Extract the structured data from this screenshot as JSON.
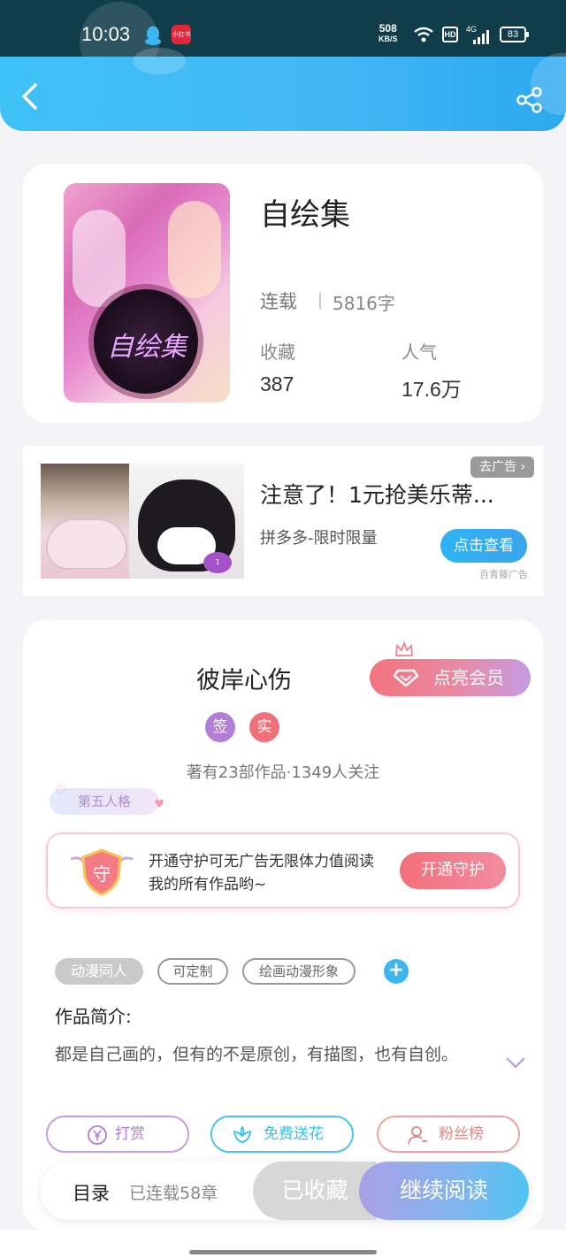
{
  "status_bar": {
    "time": "10:03",
    "app_badge": "小红书",
    "speed_value": "508",
    "speed_unit": "KB/S",
    "hd": "HD",
    "network": "4G",
    "battery": "83"
  },
  "book": {
    "title": "自绘集",
    "status": "连载",
    "word_count": "5816字",
    "stats": [
      {
        "label": "收藏",
        "value": "387"
      },
      {
        "label": "人气",
        "value": "17.6万"
      }
    ]
  },
  "ad": {
    "badge": "去广告",
    "title": "注意了！1元抢美乐蒂...",
    "subtitle": "拼多多-限时限量",
    "button": "点击查看",
    "source": "百青藤广告"
  },
  "author": {
    "name": "彼岸心伤",
    "vip_button": "点亮会员",
    "badges": [
      {
        "label": "签",
        "color": "#b57ed6"
      },
      {
        "label": "实",
        "color": "#ef7079"
      }
    ],
    "meta": "著有23部作品·1349人关注"
  },
  "fan_tag": "第五人格",
  "guard": {
    "icon_label": "守",
    "text": "开通守护可无广告无限体力值阅读我的所有作品哟~",
    "button": "开通守护"
  },
  "tags": [
    "动漫同人",
    "可定制",
    "绘画动漫形象"
  ],
  "intro": {
    "label": "作品简介:",
    "text": "都是自己画的，但有的不是原创，有描图，也有自创。"
  },
  "actions": [
    {
      "label": "打赏",
      "color": "#b07ad8"
    },
    {
      "label": "免费送花",
      "color": "#37bfe6"
    },
    {
      "label": "粉丝榜",
      "color": "#e9847f"
    }
  ],
  "bottom_bar": {
    "toc": "目录",
    "chapters": "已连载58章",
    "collected": "已收藏",
    "read": "继续阅读"
  }
}
